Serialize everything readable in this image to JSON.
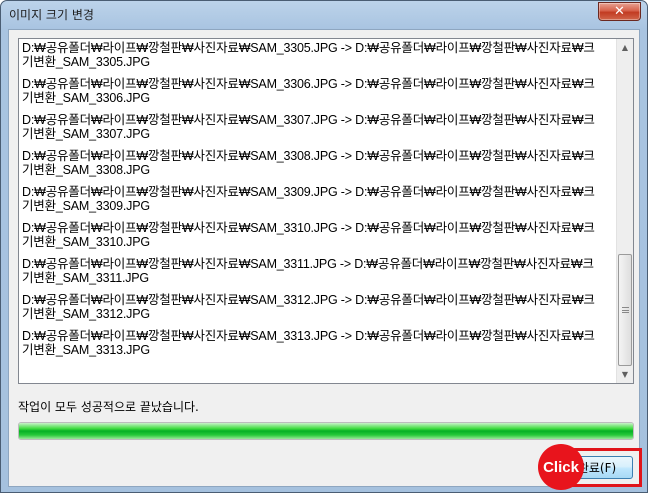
{
  "window": {
    "title": "이미지 크기 변경",
    "close_label": "✕"
  },
  "log": {
    "entries": [
      {
        "line1": "D:₩공유폴더₩라이프₩깡철판₩사진자료₩SAM_3305.JPG -> D:₩공유폴더₩라이프₩깡철판₩사진자료₩크",
        "line2": "기변환_SAM_3305.JPG"
      },
      {
        "line1": "D:₩공유폴더₩라이프₩깡철판₩사진자료₩SAM_3306.JPG -> D:₩공유폴더₩라이프₩깡철판₩사진자료₩크",
        "line2": "기변환_SAM_3306.JPG"
      },
      {
        "line1": "D:₩공유폴더₩라이프₩깡철판₩사진자료₩SAM_3307.JPG -> D:₩공유폴더₩라이프₩깡철판₩사진자료₩크",
        "line2": "기변환_SAM_3307.JPG"
      },
      {
        "line1": "D:₩공유폴더₩라이프₩깡철판₩사진자료₩SAM_3308.JPG -> D:₩공유폴더₩라이프₩깡철판₩사진자료₩크",
        "line2": "기변환_SAM_3308.JPG"
      },
      {
        "line1": "D:₩공유폴더₩라이프₩깡철판₩사진자료₩SAM_3309.JPG -> D:₩공유폴더₩라이프₩깡철판₩사진자료₩크",
        "line2": "기변환_SAM_3309.JPG"
      },
      {
        "line1": "D:₩공유폴더₩라이프₩깡철판₩사진자료₩SAM_3310.JPG -> D:₩공유폴더₩라이프₩깡철판₩사진자료₩크",
        "line2": "기변환_SAM_3310.JPG"
      },
      {
        "line1": "D:₩공유폴더₩라이프₩깡철판₩사진자료₩SAM_3311.JPG -> D:₩공유폴더₩라이프₩깡철판₩사진자료₩크",
        "line2": "기변환_SAM_3311.JPG"
      },
      {
        "line1": "D:₩공유폴더₩라이프₩깡철판₩사진자료₩SAM_3312.JPG -> D:₩공유폴더₩라이프₩깡철판₩사진자료₩크",
        "line2": "기변환_SAM_3312.JPG"
      },
      {
        "line1": "D:₩공유폴더₩라이프₩깡철판₩사진자료₩SAM_3313.JPG -> D:₩공유폴더₩라이프₩깡철판₩사진자료₩크",
        "line2": "기변환_SAM_3313.JPG"
      }
    ]
  },
  "status": {
    "message": "작업이 모두 성공적으로 끝났습니다.",
    "progress_percent": 100
  },
  "actions": {
    "finish_label": "완료(F)"
  },
  "annotation": {
    "click_label": "Click",
    "color": "#e8141c"
  },
  "icons": {
    "close": "close-icon",
    "scroll_up": "arrow-up-icon",
    "scroll_down": "arrow-down-icon"
  }
}
